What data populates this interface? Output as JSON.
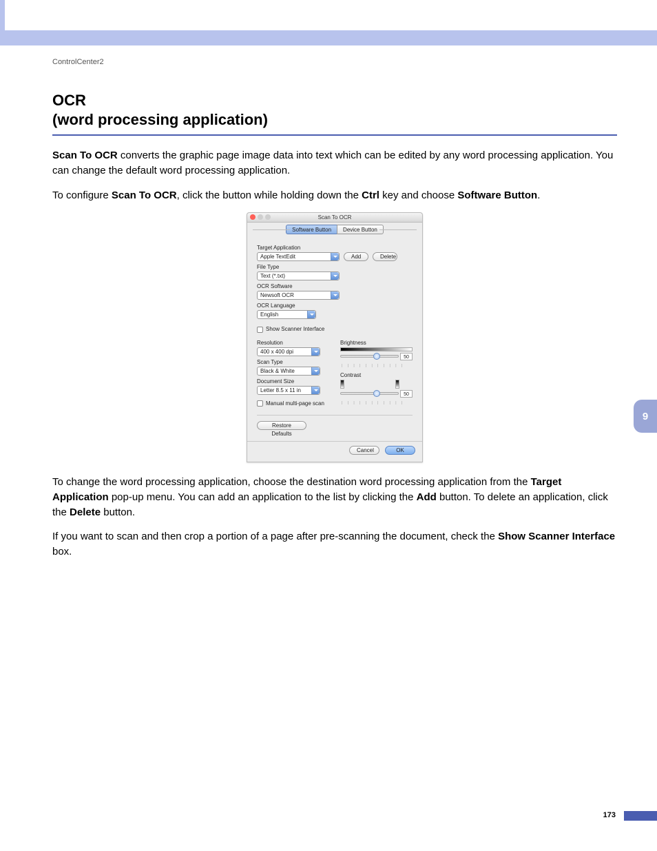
{
  "page": {
    "header": "ControlCenter2",
    "title_line1": "OCR",
    "title_line2": "(word processing application)",
    "p1_a": "Scan To OCR",
    "p1_b": " converts the graphic page image data into text which can be edited by any word processing application. You can change the default word processing application.",
    "p2_a": "To configure ",
    "p2_b": "Scan To OCR",
    "p2_c": ", click the button while holding down the ",
    "p2_d": "Ctrl",
    "p2_e": " key and choose ",
    "p2_f": "Software Button",
    "p2_g": ".",
    "p3_a": "To change the word processing application, choose the destination word processing application from the ",
    "p3_b": "Target Application",
    "p3_c": " pop-up menu. You can add an application to the list by clicking the ",
    "p3_d": "Add",
    "p3_e": " button. To delete an application, click the ",
    "p3_f": "Delete",
    "p3_g": " button.",
    "p4_a": "If you want to scan and then crop a portion of a page after pre-scanning the document, check the ",
    "p4_b": "Show Scanner Interface",
    "p4_c": " box.",
    "side_tab": "9",
    "page_number": "173"
  },
  "dialog": {
    "title": "Scan To OCR",
    "tab_software": "Software Button",
    "tab_device": "Device Button",
    "labels": {
      "target_app": "Target Application",
      "file_type": "File Type",
      "ocr_software": "OCR Software",
      "ocr_language": "OCR Language",
      "show_scanner": "Show Scanner Interface",
      "resolution": "Resolution",
      "scan_type": "Scan Type",
      "document_size": "Document Size",
      "manual_multi": "Manual multi-page scan",
      "brightness": "Brightness",
      "contrast": "Contrast"
    },
    "values": {
      "target_app": "Apple TextEdit",
      "file_type": "Text (*.txt)",
      "ocr_software": "Newsoft OCR",
      "ocr_language": "English",
      "resolution": "400 x 400 dpi",
      "scan_type": "Black & White",
      "document_size": "Letter  8.5 x 11 in",
      "brightness": "50",
      "contrast": "50"
    },
    "buttons": {
      "add": "Add",
      "delete": "Delete",
      "restore": "Restore Defaults",
      "cancel": "Cancel",
      "ok": "OK"
    }
  }
}
